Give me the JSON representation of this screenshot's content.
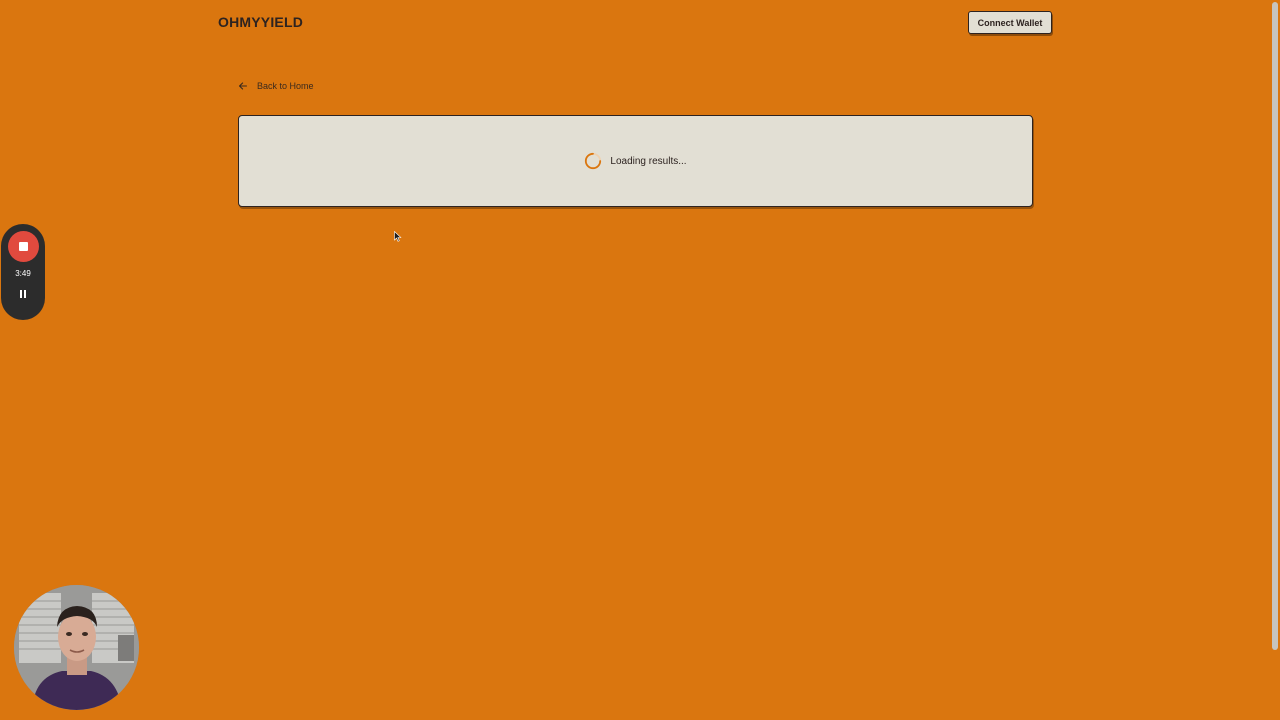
{
  "header": {
    "logo": "OHMYYIELD",
    "connect_wallet_label": "Connect Wallet"
  },
  "nav": {
    "back_label": "Back to Home"
  },
  "main": {
    "loading_text": "Loading results..."
  },
  "recorder": {
    "elapsed_time": "3:49"
  },
  "colors": {
    "background": "#da760f",
    "card": "#e2dfd4",
    "text_dark": "#2d2320",
    "record_red": "#e14a3e",
    "widget_dark": "#2c2c2c"
  },
  "icons": {
    "back": "arrow-left-icon",
    "spinner": "spinner-icon",
    "stop": "stop-icon",
    "pause": "pause-icon",
    "cursor": "mouse-cursor-icon"
  }
}
